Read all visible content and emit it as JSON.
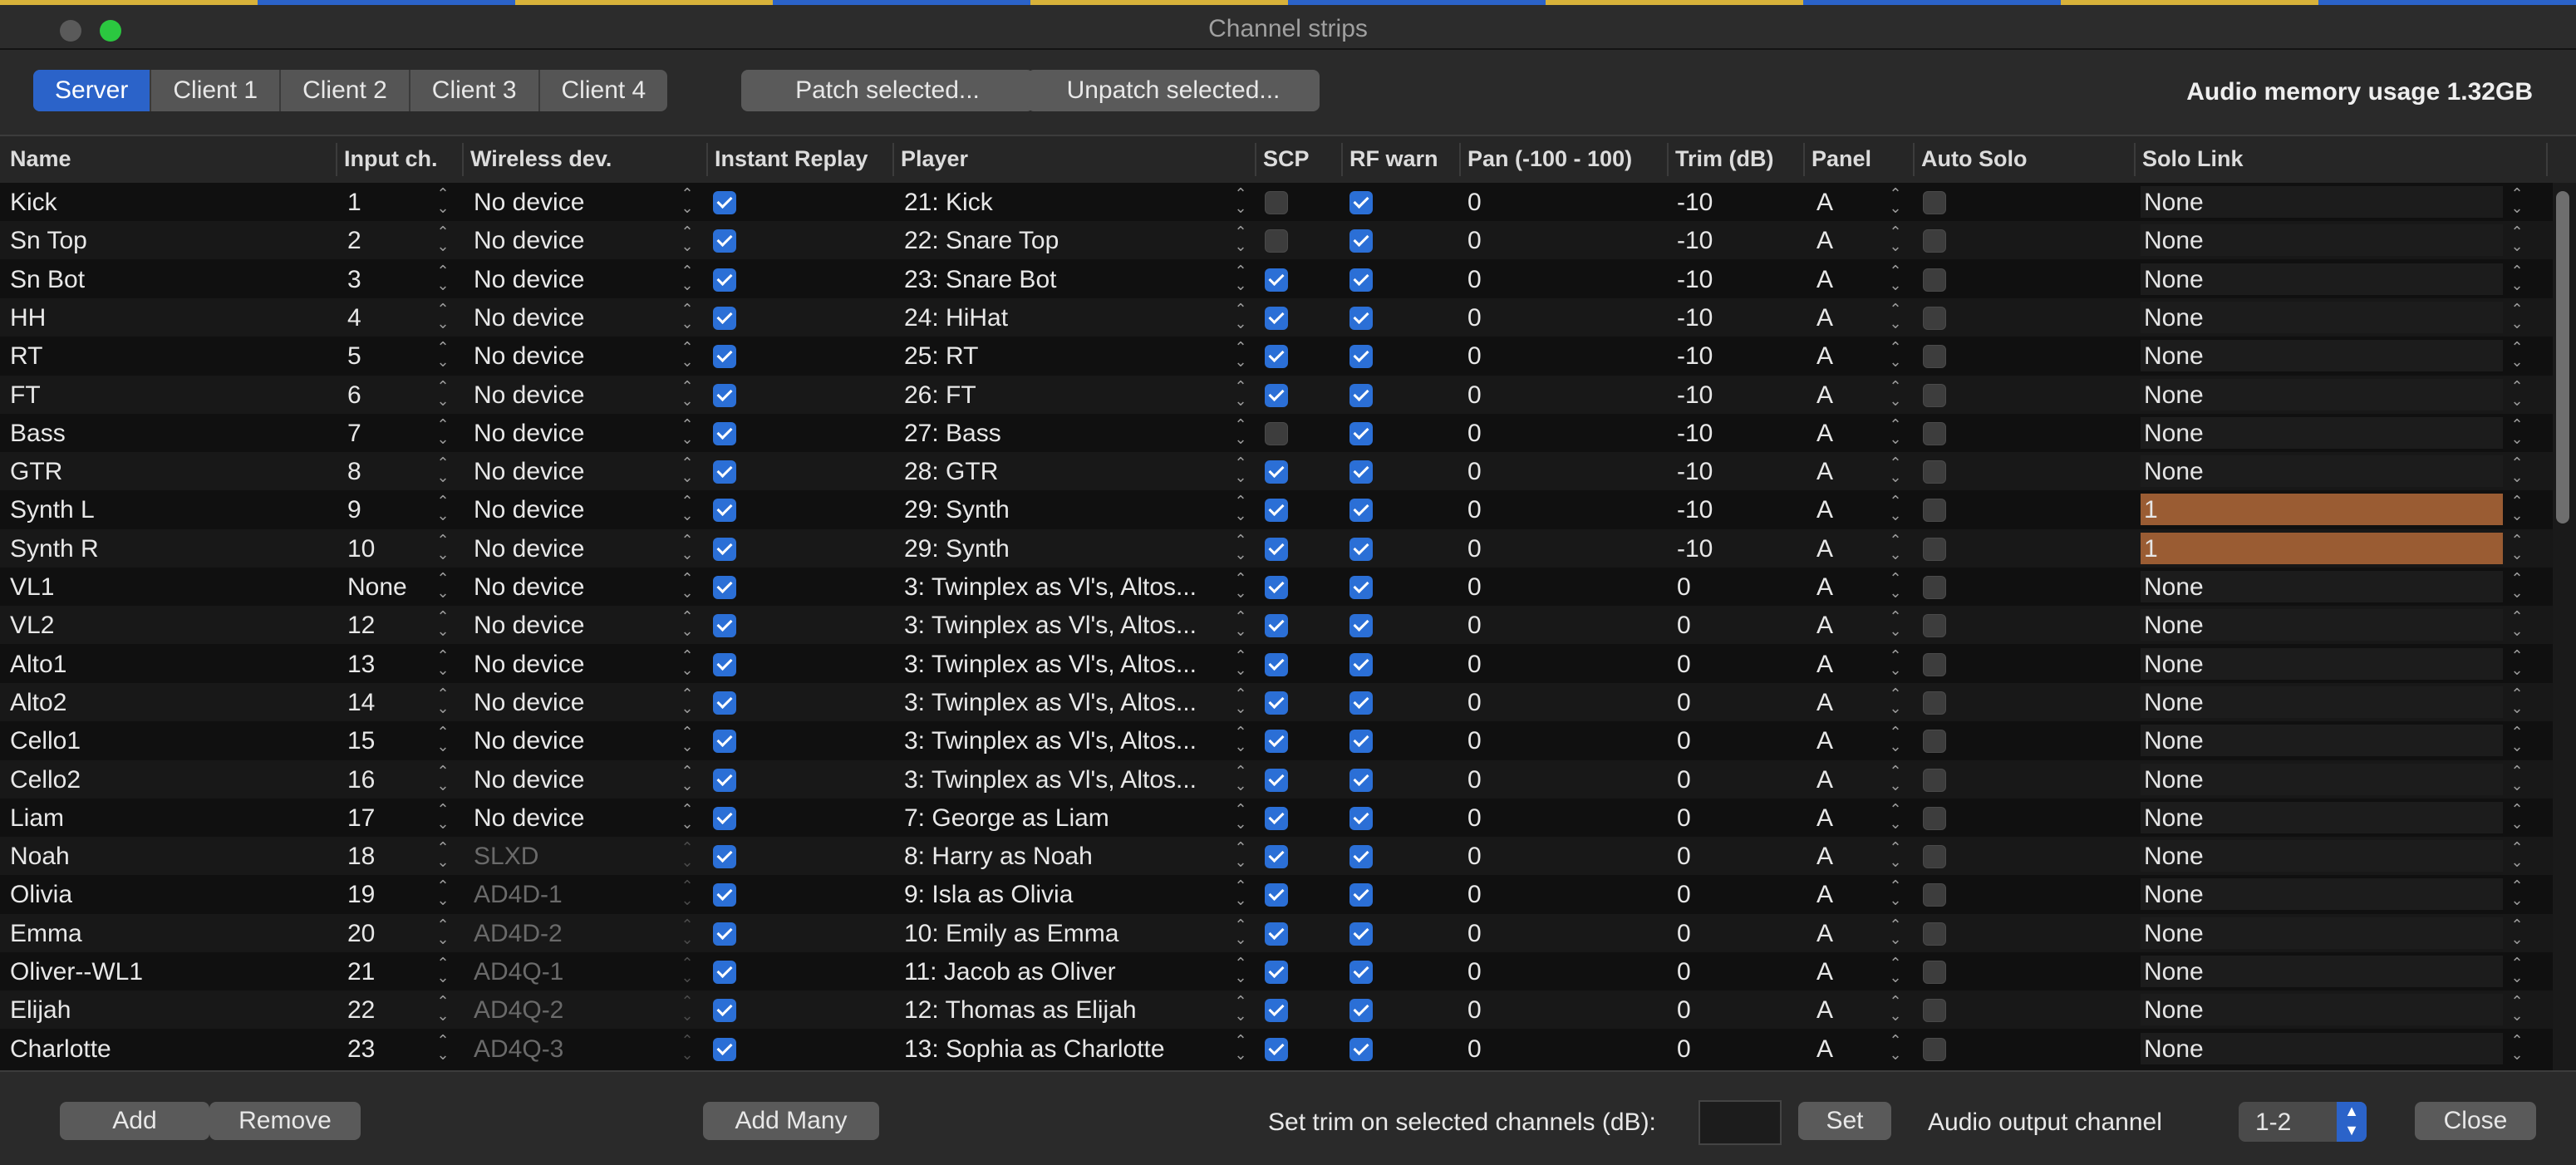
{
  "window": {
    "title": "Channel strips",
    "top_strip_colors": [
      "#d8b23a",
      "#2b63c9",
      "#d8b23a",
      "#2b63c9",
      "#d8b23a",
      "#2b63c9",
      "#d8b23a",
      "#2b63c9",
      "#d8b23a",
      "#2b63c9"
    ],
    "traffic_colors": [
      "#5a5a5a",
      "#2bc840"
    ]
  },
  "toolbar": {
    "tabs": [
      "Server",
      "Client 1",
      "Client 2",
      "Client 3",
      "Client 4"
    ],
    "active_tab": 0,
    "patch_label": "Patch selected...",
    "unpatch_label": "Unpatch selected...",
    "memory_label": "Audio memory usage 1.32GB"
  },
  "columns": [
    "Name",
    "Input ch.",
    "Wireless dev.",
    "Instant Replay",
    "Player",
    "SCP",
    "RF warn",
    "Pan (-100 - 100)",
    "Trim (dB)",
    "Panel",
    "Auto Solo",
    "Solo Link"
  ],
  "rows": [
    {
      "name": "Kick",
      "input": "1",
      "wireless": "No device",
      "wdim": false,
      "ir": true,
      "player": "21: Kick",
      "scp": false,
      "rf": true,
      "pan": "0",
      "trim": "-10",
      "panel": "A",
      "autosolo": false,
      "solo": "None",
      "linked": false
    },
    {
      "name": "Sn Top",
      "input": "2",
      "wireless": "No device",
      "wdim": false,
      "ir": true,
      "player": "22: Snare Top",
      "scp": false,
      "rf": true,
      "pan": "0",
      "trim": "-10",
      "panel": "A",
      "autosolo": false,
      "solo": "None",
      "linked": false
    },
    {
      "name": "Sn Bot",
      "input": "3",
      "wireless": "No device",
      "wdim": false,
      "ir": true,
      "player": "23: Snare Bot",
      "scp": true,
      "rf": true,
      "pan": "0",
      "trim": "-10",
      "panel": "A",
      "autosolo": false,
      "solo": "None",
      "linked": false
    },
    {
      "name": "HH",
      "input": "4",
      "wireless": "No device",
      "wdim": false,
      "ir": true,
      "player": "24: HiHat",
      "scp": true,
      "rf": true,
      "pan": "0",
      "trim": "-10",
      "panel": "A",
      "autosolo": false,
      "solo": "None",
      "linked": false
    },
    {
      "name": "RT",
      "input": "5",
      "wireless": "No device",
      "wdim": false,
      "ir": true,
      "player": "25: RT",
      "scp": true,
      "rf": true,
      "pan": "0",
      "trim": "-10",
      "panel": "A",
      "autosolo": false,
      "solo": "None",
      "linked": false
    },
    {
      "name": "FT",
      "input": "6",
      "wireless": "No device",
      "wdim": false,
      "ir": true,
      "player": "26: FT",
      "scp": true,
      "rf": true,
      "pan": "0",
      "trim": "-10",
      "panel": "A",
      "autosolo": false,
      "solo": "None",
      "linked": false
    },
    {
      "name": "Bass",
      "input": "7",
      "wireless": "No device",
      "wdim": false,
      "ir": true,
      "player": "27: Bass",
      "scp": false,
      "rf": true,
      "pan": "0",
      "trim": "-10",
      "panel": "A",
      "autosolo": false,
      "solo": "None",
      "linked": false
    },
    {
      "name": "GTR",
      "input": "8",
      "wireless": "No device",
      "wdim": false,
      "ir": true,
      "player": "28: GTR",
      "scp": true,
      "rf": true,
      "pan": "0",
      "trim": "-10",
      "panel": "A",
      "autosolo": false,
      "solo": "None",
      "linked": false
    },
    {
      "name": "Synth L",
      "input": "9",
      "wireless": "No device",
      "wdim": false,
      "ir": true,
      "player": "29: Synth",
      "scp": true,
      "rf": true,
      "pan": "0",
      "trim": "-10",
      "panel": "A",
      "autosolo": false,
      "solo": "1",
      "linked": true
    },
    {
      "name": "Synth R",
      "input": "10",
      "wireless": "No device",
      "wdim": false,
      "ir": true,
      "player": "29: Synth",
      "scp": true,
      "rf": true,
      "pan": "0",
      "trim": "-10",
      "panel": "A",
      "autosolo": false,
      "solo": "1",
      "linked": true
    },
    {
      "name": "VL1",
      "input": "None",
      "wireless": "No device",
      "wdim": false,
      "ir": true,
      "player": "3: Twinplex as Vl's, Altos...",
      "scp": true,
      "rf": true,
      "pan": "0",
      "trim": "0",
      "panel": "A",
      "autosolo": false,
      "solo": "None",
      "linked": false
    },
    {
      "name": "VL2",
      "input": "12",
      "wireless": "No device",
      "wdim": false,
      "ir": true,
      "player": "3: Twinplex as Vl's, Altos...",
      "scp": true,
      "rf": true,
      "pan": "0",
      "trim": "0",
      "panel": "A",
      "autosolo": false,
      "solo": "None",
      "linked": false
    },
    {
      "name": "Alto1",
      "input": "13",
      "wireless": "No device",
      "wdim": false,
      "ir": true,
      "player": "3: Twinplex as Vl's, Altos...",
      "scp": true,
      "rf": true,
      "pan": "0",
      "trim": "0",
      "panel": "A",
      "autosolo": false,
      "solo": "None",
      "linked": false
    },
    {
      "name": "Alto2",
      "input": "14",
      "wireless": "No device",
      "wdim": false,
      "ir": true,
      "player": "3: Twinplex as Vl's, Altos...",
      "scp": true,
      "rf": true,
      "pan": "0",
      "trim": "0",
      "panel": "A",
      "autosolo": false,
      "solo": "None",
      "linked": false
    },
    {
      "name": "Cello1",
      "input": "15",
      "wireless": "No device",
      "wdim": false,
      "ir": true,
      "player": "3: Twinplex as Vl's, Altos...",
      "scp": true,
      "rf": true,
      "pan": "0",
      "trim": "0",
      "panel": "A",
      "autosolo": false,
      "solo": "None",
      "linked": false
    },
    {
      "name": "Cello2",
      "input": "16",
      "wireless": "No device",
      "wdim": false,
      "ir": true,
      "player": "3: Twinplex as Vl's, Altos...",
      "scp": true,
      "rf": true,
      "pan": "0",
      "trim": "0",
      "panel": "A",
      "autosolo": false,
      "solo": "None",
      "linked": false
    },
    {
      "name": "Liam",
      "input": "17",
      "wireless": "No device",
      "wdim": false,
      "ir": true,
      "player": "7: George as Liam",
      "scp": true,
      "rf": true,
      "pan": "0",
      "trim": "0",
      "panel": "A",
      "autosolo": false,
      "solo": "None",
      "linked": false
    },
    {
      "name": "Noah",
      "input": "18",
      "wireless": "SLXD",
      "wdim": true,
      "ir": true,
      "player": "8: Harry  as Noah",
      "scp": true,
      "rf": true,
      "pan": "0",
      "trim": "0",
      "panel": "A",
      "autosolo": false,
      "solo": "None",
      "linked": false
    },
    {
      "name": "Olivia",
      "input": "19",
      "wireless": "AD4D-1",
      "wdim": true,
      "ir": true,
      "player": "9: Isla  as Olivia",
      "scp": true,
      "rf": true,
      "pan": "0",
      "trim": "0",
      "panel": "A",
      "autosolo": false,
      "solo": "None",
      "linked": false
    },
    {
      "name": "Emma",
      "input": "20",
      "wireless": "AD4D-2",
      "wdim": true,
      "ir": true,
      "player": "10: Emily  as Emma",
      "scp": true,
      "rf": true,
      "pan": "0",
      "trim": "0",
      "panel": "A",
      "autosolo": false,
      "solo": "None",
      "linked": false
    },
    {
      "name": "Oliver--WL1",
      "input": "21",
      "wireless": "AD4Q-1",
      "wdim": true,
      "ir": true,
      "player": "11: Jacob as Oliver",
      "scp": true,
      "rf": true,
      "pan": "0",
      "trim": "0",
      "panel": "A",
      "autosolo": false,
      "solo": "None",
      "linked": false
    },
    {
      "name": "Elijah",
      "input": "22",
      "wireless": "AD4Q-2",
      "wdim": true,
      "ir": true,
      "player": "12: Thomas as Elijah",
      "scp": true,
      "rf": true,
      "pan": "0",
      "trim": "0",
      "panel": "A",
      "autosolo": false,
      "solo": "None",
      "linked": false
    },
    {
      "name": "Charlotte",
      "input": "23",
      "wireless": "AD4Q-3",
      "wdim": true,
      "ir": true,
      "player": "13: Sophia as Charlotte",
      "scp": true,
      "rf": true,
      "pan": "0",
      "trim": "0",
      "panel": "A",
      "autosolo": false,
      "solo": "None",
      "linked": false
    }
  ],
  "footer": {
    "add_label": "Add",
    "remove_label": "Remove",
    "add_many_label": "Add Many",
    "trim_label": "Set trim on selected channels (dB):",
    "trim_value": "",
    "set_label": "Set",
    "output_label": "Audio output channel",
    "output_value": "1-2",
    "close_label": "Close"
  }
}
